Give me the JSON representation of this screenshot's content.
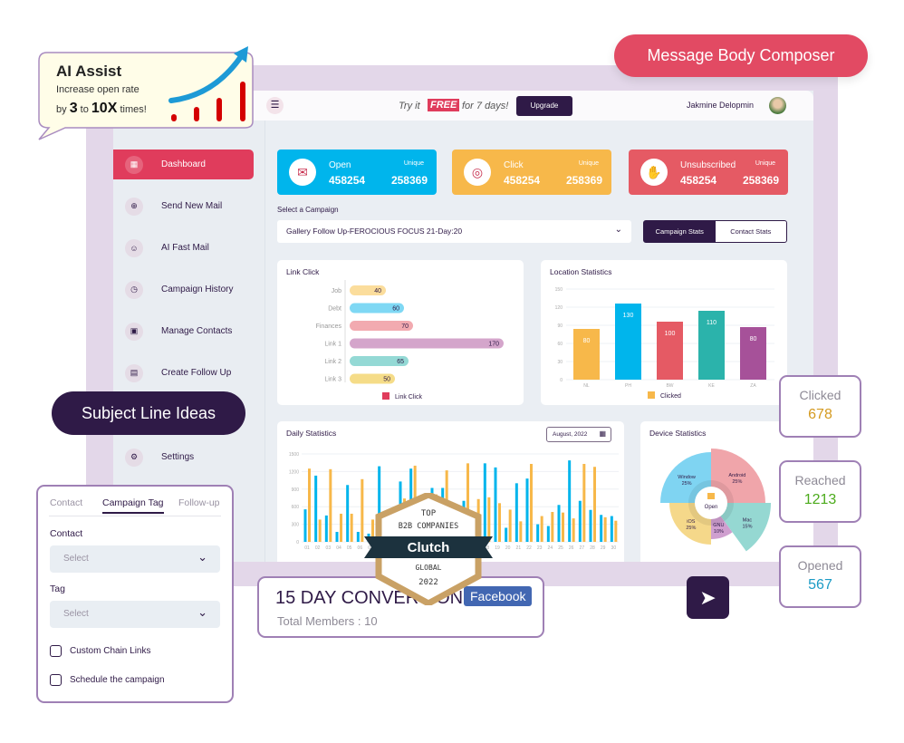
{
  "header": {
    "try_prefix": "Try it",
    "free": "FREE",
    "try_suffix": "for 7 days!",
    "upgrade": "Upgrade",
    "user_name": "Jakmine Delopmin"
  },
  "sidebar": {
    "items": [
      {
        "label": "Dashboard",
        "icon": "dashboard-icon",
        "active": true
      },
      {
        "label": "Send New Mail",
        "icon": "mail-plus-icon"
      },
      {
        "label": "AI Fast Mail",
        "icon": "ai-head-icon"
      },
      {
        "label": "Campaign History",
        "icon": "clock-icon"
      },
      {
        "label": "Manage Contacts",
        "icon": "contacts-icon"
      },
      {
        "label": "Create Follow Up",
        "icon": "file-icon"
      },
      {
        "label": "Settings",
        "icon": "gear-icon"
      }
    ]
  },
  "stats": [
    {
      "name": "Open",
      "value": "458254",
      "unique_label": "Unique",
      "unique": "258369",
      "color": "#00b5ec",
      "icon": "envelope-open-icon"
    },
    {
      "name": "Click",
      "value": "458254",
      "unique_label": "Unique",
      "unique": "258369",
      "color": "#f7b84a",
      "icon": "cursor-click-icon"
    },
    {
      "name": "Unsubscribed",
      "value": "458254",
      "unique_label": "Unique",
      "unique": "258369",
      "color": "#e55a64",
      "icon": "unsubscribe-hand-icon"
    }
  ],
  "campaign": {
    "label": "Select a Campaign",
    "selected": "Gallery Follow Up-FEROCIOUS FOCUS 21-Day:20",
    "tabs": [
      "Campaign Stats",
      "Contact Stats"
    ],
    "active_tab": 0
  },
  "chart_data": [
    {
      "type": "bar",
      "orientation": "horizontal",
      "title": "Link Click",
      "categories": [
        "Job",
        "Debt",
        "Finances",
        "Link 1",
        "Link 2",
        "Link 3"
      ],
      "values": [
        40,
        60,
        70,
        170,
        65,
        50
      ],
      "colors": [
        "#fbdd9c",
        "#7fd8f4",
        "#f2aab0",
        "#d4a5cb",
        "#94d9d5",
        "#f5dc88"
      ],
      "legend": [
        "Link Click"
      ],
      "legend_color": "#e03c5c",
      "xlim": [
        0,
        180
      ]
    },
    {
      "type": "bar",
      "title": "Location Statistics",
      "categories": [
        "NL",
        "PH",
        "BW",
        "KE",
        "ZA"
      ],
      "values": [
        80,
        130,
        100,
        110,
        80
      ],
      "bar_heights": [
        84,
        126,
        96,
        114,
        87
      ],
      "colors": [
        "#f7b84a",
        "#00b5ec",
        "#e55a64",
        "#2bb3ab",
        "#a65199"
      ],
      "legend": [
        "Clicked"
      ],
      "legend_color": "#f7b84a",
      "ylim": [
        0,
        150
      ],
      "yticks": [
        0,
        30,
        60,
        90,
        120,
        150
      ],
      "grid": true
    },
    {
      "type": "bar",
      "title": "Daily Statistics",
      "period": "August, 2022",
      "categories": [
        "01",
        "02",
        "03",
        "04",
        "05",
        "06",
        "07",
        "08",
        "09",
        "10",
        "11",
        "12",
        "13",
        "14",
        "15",
        "16",
        "17",
        "18",
        "19",
        "20",
        "21",
        "22",
        "23",
        "24",
        "25",
        "26",
        "27",
        "28",
        "29",
        "30"
      ],
      "series": [
        {
          "color": "#00b5ec",
          "values": [
            555,
            1130,
            450,
            170,
            970,
            170,
            140,
            1290,
            330,
            1030,
            1250,
            600,
            920,
            920,
            500,
            700,
            450,
            1340,
            1270,
            240,
            1000,
            1080,
            300,
            270,
            630,
            1390,
            700,
            545,
            460,
            440
          ]
        },
        {
          "color": "#f7b84a",
          "values": [
            1250,
            380,
            1240,
            480,
            480,
            1070,
            380,
            290,
            490,
            740,
            1300,
            500,
            810,
            1220,
            400,
            1340,
            730,
            760,
            660,
            550,
            350,
            1330,
            440,
            510,
            500,
            400,
            1330,
            1280,
            420,
            360
          ]
        }
      ],
      "ylim": [
        0,
        1500
      ],
      "yticks": [
        0,
        300,
        600,
        900,
        1200,
        1500
      ],
      "grid": true
    },
    {
      "type": "pie",
      "title": "Device Statistics",
      "center_label": "Open",
      "categories": [
        "Android",
        "Mac",
        "GNU",
        "iOS",
        "Window"
      ],
      "values": [
        25,
        15,
        10,
        25,
        25
      ],
      "colors": [
        "#f0a5aa",
        "#95d8d2",
        "#cf9fcf",
        "#f5d88a",
        "#7fd4f2"
      ]
    }
  ],
  "floating": {
    "message_body": "Message Body Composer",
    "ai_assist": {
      "title": "AI Assist",
      "line1": "Increase open rate",
      "by": "by",
      "n1": "3",
      "to": "to",
      "n2": "10X",
      "times": "times!"
    },
    "subject_line": "Subject Line Ideas",
    "panel": {
      "tabs": [
        "Contact",
        "Campaign Tag",
        "Follow-up"
      ],
      "active_tab": 1,
      "contact_label": "Contact",
      "contact_placeholder": "Select",
      "tag_label": "Tag",
      "tag_placeholder": "Select",
      "checks": [
        "Custom Chain Links",
        "Schedule the campaign"
      ]
    },
    "conversion": {
      "title": "15 DAY CONVERSION",
      "badge": "Facebook",
      "members": "Total Members : 10"
    },
    "clutch": {
      "top": "TOP",
      "b2b": "B2B COMPANIES",
      "brand": "Clutch",
      "global": "GLOBAL",
      "year": "2022"
    },
    "metrics": [
      {
        "label": "Clicked",
        "value": "678",
        "color": "#d49a1f"
      },
      {
        "label": "Reached",
        "value": "1213",
        "color": "#4cab1c"
      },
      {
        "label": "Opened",
        "value": "567",
        "color": "#1b9bc5"
      }
    ]
  }
}
